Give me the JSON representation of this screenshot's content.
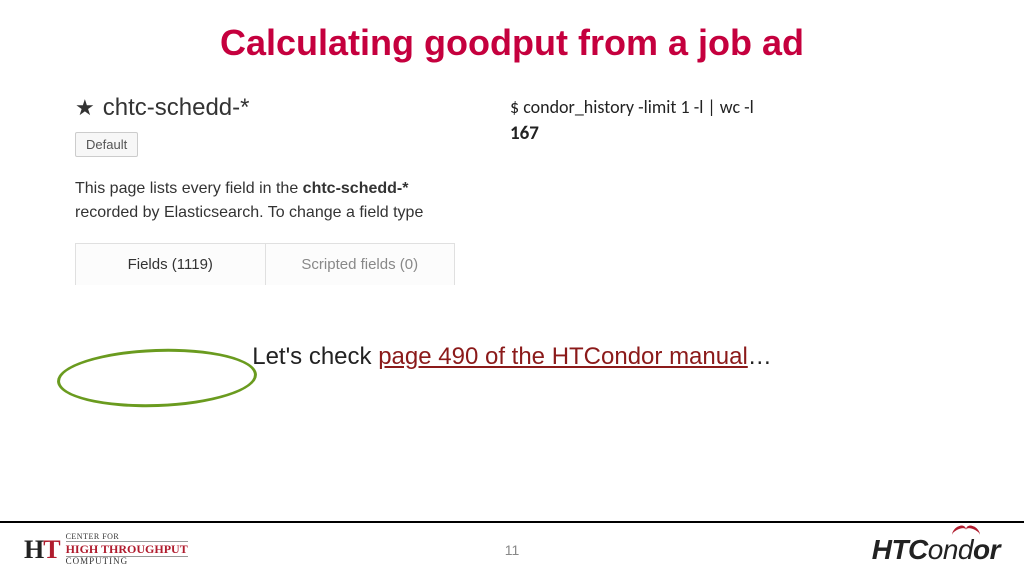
{
  "title": "Calculating goodput from a job ad",
  "pattern": {
    "name": "chtc-schedd-*",
    "default_label": "Default",
    "desc_prefix": "This page lists every field in the ",
    "desc_bold": "chtc-schedd-*",
    "desc_line2": "recorded by Elasticsearch. To change a field type"
  },
  "tabs": {
    "fields": "Fields (1119)",
    "scripted": "Scripted fields (0)"
  },
  "shell": {
    "cmd": "$ condor_history -limit 1 -l | wc -l",
    "out": "167"
  },
  "lets": {
    "prefix": "Let's check ",
    "link": "page 490 of the HTCondor manual",
    "suffix": "…"
  },
  "footer": {
    "page": "11",
    "chtc": {
      "ht": "H",
      "t": "T",
      "line1": "CENTER FOR",
      "line2": "HIGH THROUGHPUT",
      "line3": "COMPUTING"
    },
    "htcondor": {
      "ht": "HT",
      "c": "C",
      "on": "ond",
      "or": "or"
    }
  }
}
